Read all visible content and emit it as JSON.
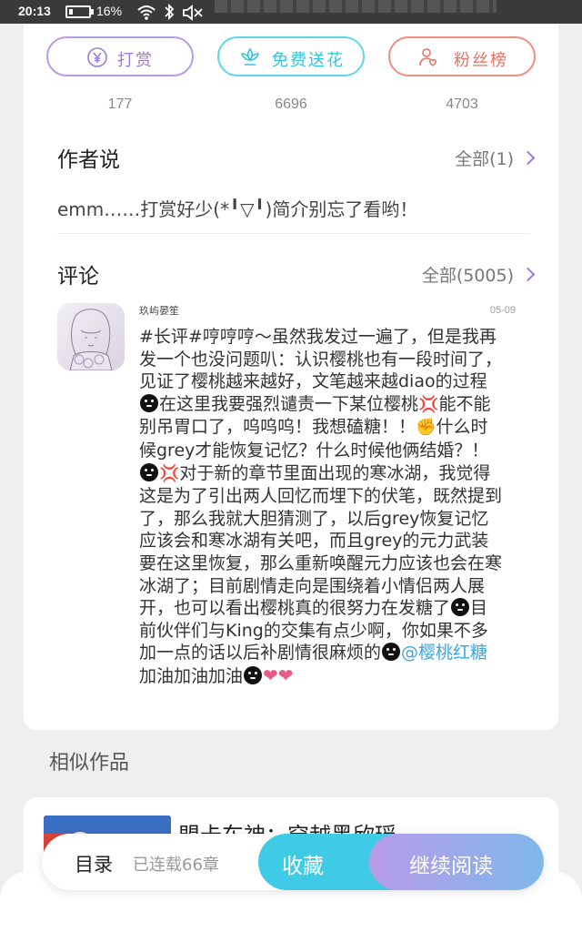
{
  "status_bar": {
    "time": "20:13",
    "battery": "16%"
  },
  "actions": [
    {
      "label": "打赏",
      "count": "177"
    },
    {
      "label": "免费送花",
      "count": "6696"
    },
    {
      "label": "粉丝榜",
      "count": "4703"
    }
  ],
  "author_note": {
    "title": "作者说",
    "more": "全部(1)",
    "text": "emm……打赏好少(*╹▽╹)简介别忘了看哟！"
  },
  "comments": {
    "title": "评论",
    "more": "全部(5005)",
    "items": [
      {
        "user": "玖屿晏笙",
        "date": "05-09",
        "text_parts": [
          "#长评#哼哼哼～虽然我发过一遍了，但是我再发一个也没问题叭：认识樱桃也有一段时间了，见证了樱桃越来越好，文笔越来越diao的过程",
          "在这里我要强烈谴责一下某位樱桃",
          "能不能别吊胃口了，呜呜呜！我想磕糖！！",
          "什么时候grey才能恢复记忆？什么时候他俩结婚？！",
          "对于新的章节里面出现的寒冰湖，我觉得这是为了引出两人回忆而埋下的伏笔，既然提到了，那么我就大胆猜测了，以后grey恢复记忆应该会和寒冰湖有关吧，而且grey的元力武装要在这里恢复，那么重新唤醒元力应该也会在寒冰湖了；目前剧情走向是围绕着小情侣两人展开，也可以看出樱桃真的很努力在发糖了",
          "目前伙伴们与King的交集有点少啊，你如果不多加一点的话以后补剧情很麻烦的",
          "@樱桃红糖",
          " 加油加油加油"
        ]
      }
    ]
  },
  "similar": {
    "title": "相似作品",
    "books": [
      {
        "title": "盟卡车神：穿越黑欣瑶"
      }
    ]
  },
  "bottom_bar": {
    "toc_label": "目录",
    "serial_status": "已连载66章",
    "collect_label": "收藏",
    "read_label": "继续阅读"
  }
}
